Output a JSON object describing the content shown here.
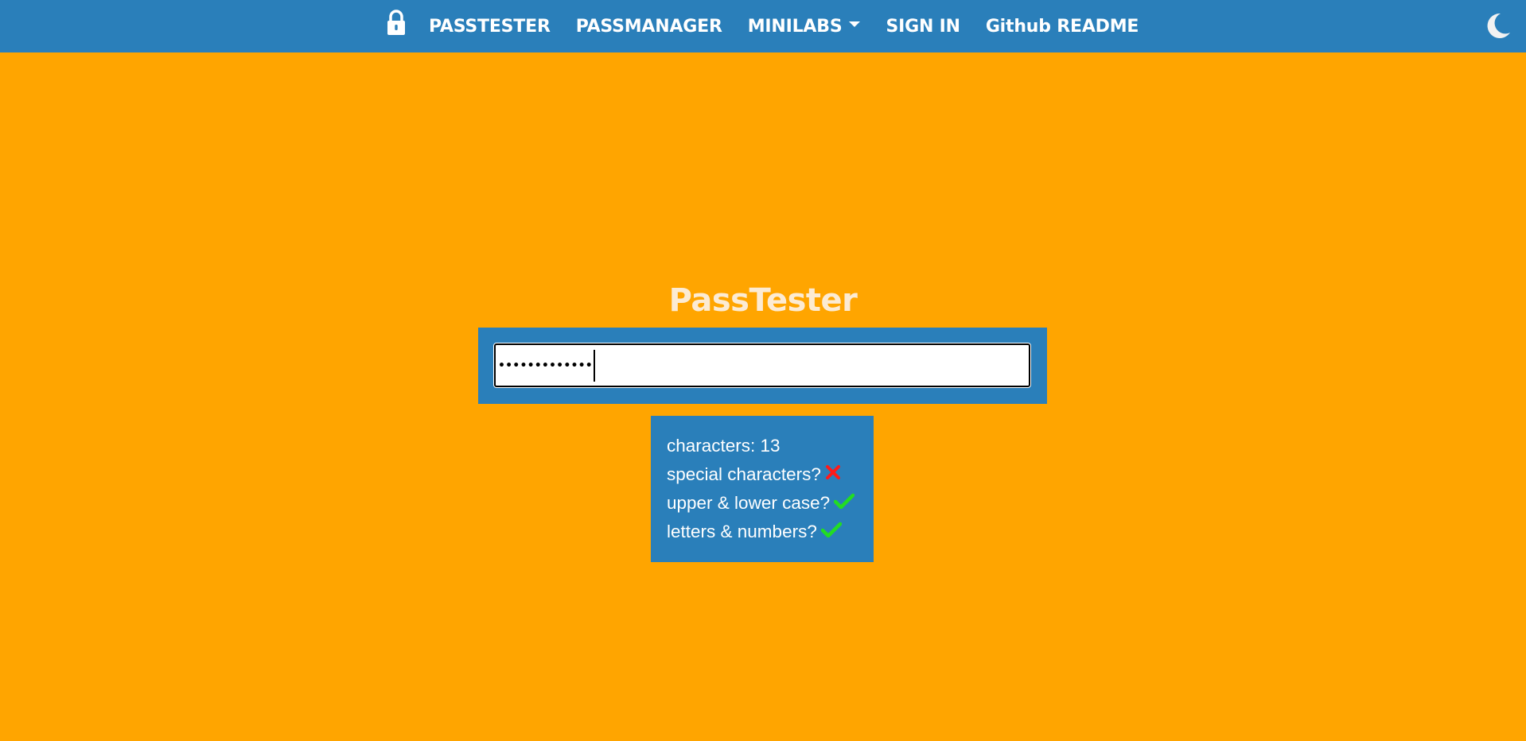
{
  "nav": {
    "lock_icon": "lock-icon",
    "links": {
      "passtester": "PASSTESTER",
      "passmanager": "PASSMANAGER",
      "minilabs": "MINILABS",
      "signin": "SIGN IN",
      "github": "Github README"
    },
    "theme_icon": "moon-icon"
  },
  "main": {
    "title": "PassTester",
    "password_masked": "•••••••••••••",
    "stats": {
      "characters_label": "characters: 13",
      "special_label": "special characters?",
      "special_ok": false,
      "case_label": "upper & lower case?",
      "case_ok": true,
      "alnum_label": "letters & numbers?",
      "alnum_ok": true
    }
  },
  "colors": {
    "background": "#FFA500",
    "nav": "#2A7FBA",
    "panel": "#2A7FBA",
    "check": "#22DD22",
    "cross": "#FF1A1A"
  }
}
